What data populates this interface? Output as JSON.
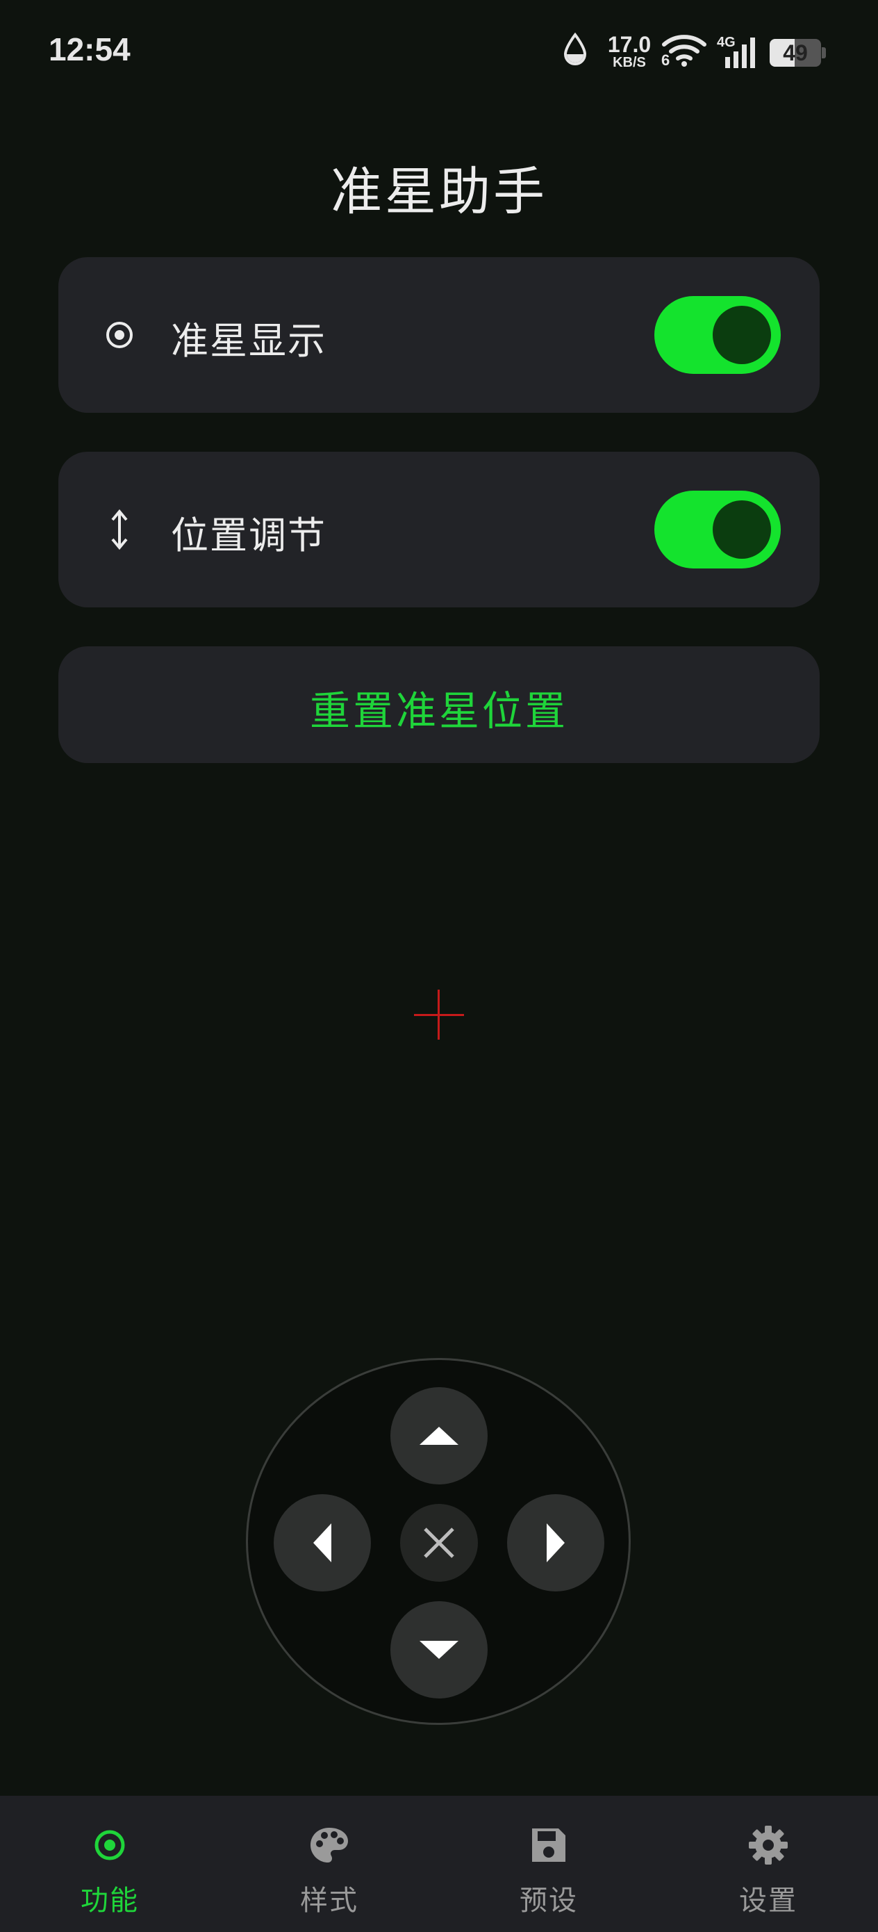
{
  "status_bar": {
    "time": "12:54",
    "net_speed_value": "17.0",
    "net_speed_unit": "KB/S",
    "wifi_badge": "6",
    "cell_label": "4G",
    "battery_percent": "49",
    "battery_level": 0.49
  },
  "title": "准星助手",
  "cards": {
    "crosshair_display": {
      "label": "准星显示",
      "icon": "target-icon",
      "enabled": true
    },
    "position_adjust": {
      "label": "位置调节",
      "icon": "vertical-arrows-icon",
      "enabled": true
    },
    "reset_button": {
      "label": "重置准星位置"
    }
  },
  "crosshair": {
    "color": "#c51a1a"
  },
  "dpad": {
    "up": "arrow-up-icon",
    "down": "arrow-down-icon",
    "left": "arrow-left-icon",
    "right": "arrow-right-icon",
    "center": "close-icon"
  },
  "bottom_nav": {
    "items": [
      {
        "label": "功能",
        "icon": "target-icon",
        "active": true
      },
      {
        "label": "样式",
        "icon": "palette-icon",
        "active": false
      },
      {
        "label": "预设",
        "icon": "save-icon",
        "active": false
      },
      {
        "label": "设置",
        "icon": "gear-icon",
        "active": false
      }
    ]
  },
  "colors": {
    "accent": "#1fd53a",
    "toggle_on": "#14e32d",
    "background": "#0e130e",
    "card": "#222327",
    "nav_bar": "#1f2024"
  }
}
